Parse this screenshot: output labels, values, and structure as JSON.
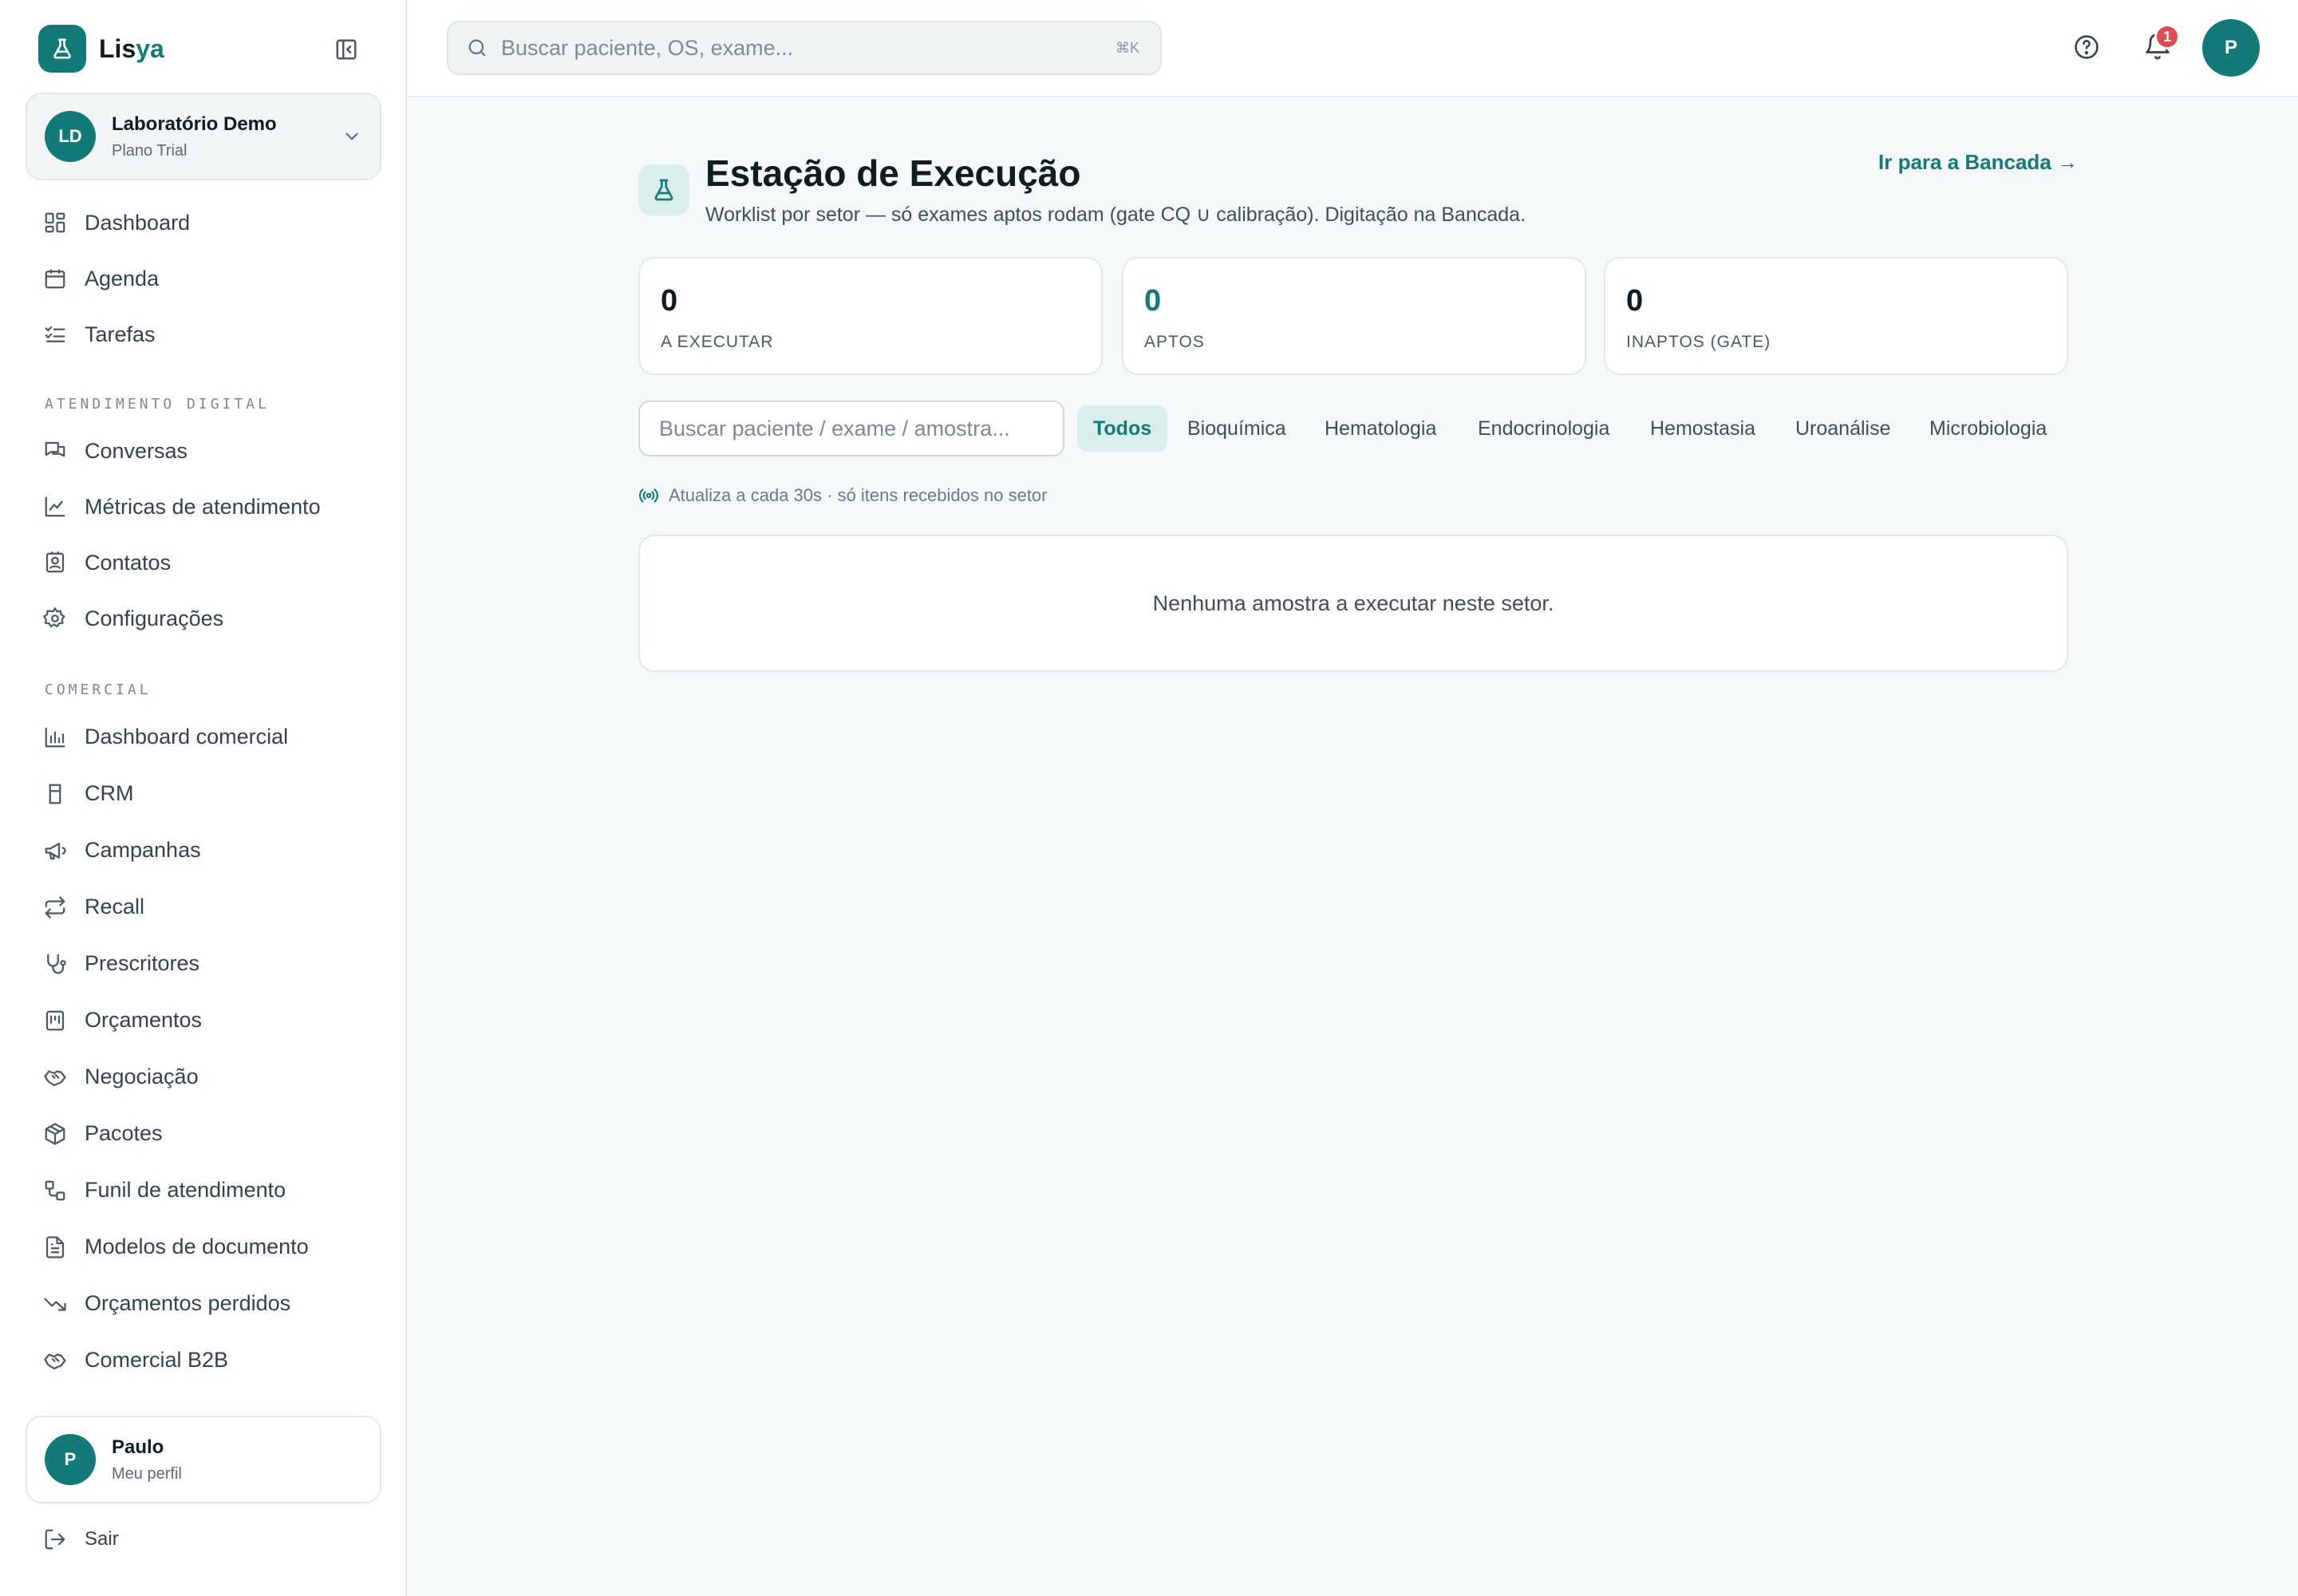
{
  "brand": {
    "name_part1": "Lis",
    "name_part2": "ya",
    "accent_color": "#137a78"
  },
  "org": {
    "initials": "LD",
    "name": "Laboratório Demo",
    "plan": "Plano Trial"
  },
  "sidebar": {
    "main_items": [
      {
        "label": "Dashboard",
        "icon": "layout-grid-icon"
      },
      {
        "label": "Agenda",
        "icon": "calendar-icon"
      },
      {
        "label": "Tarefas",
        "icon": "list-checks-icon"
      }
    ],
    "section_atendimento": "ATENDIMENTO DIGITAL",
    "atendimento_items": [
      {
        "label": "Conversas",
        "icon": "chat-bubbles-icon"
      },
      {
        "label": "Métricas de atendimento",
        "icon": "line-chart-icon"
      },
      {
        "label": "Contatos",
        "icon": "contact-card-icon"
      },
      {
        "label": "Configurações",
        "icon": "gear-icon"
      }
    ],
    "section_comercial": "COMERCIAL",
    "comercial_items": [
      {
        "label": "Dashboard comercial",
        "icon": "bar-chart-icon"
      },
      {
        "label": "CRM",
        "icon": "cylinder-icon"
      },
      {
        "label": "Campanhas",
        "icon": "megaphone-icon"
      },
      {
        "label": "Recall",
        "icon": "repeat-icon"
      },
      {
        "label": "Prescritores",
        "icon": "stethoscope-icon"
      },
      {
        "label": "Orçamentos",
        "icon": "receipt-icon"
      },
      {
        "label": "Negociação",
        "icon": "handshake-icon"
      },
      {
        "label": "Pacotes",
        "icon": "package-icon"
      },
      {
        "label": "Funil de atendimento",
        "icon": "workflow-icon"
      },
      {
        "label": "Modelos de documento",
        "icon": "file-text-icon"
      },
      {
        "label": "Orçamentos perdidos",
        "icon": "trending-down-icon"
      },
      {
        "label": "Comercial B2B",
        "icon": "handshake-icon"
      }
    ],
    "profile": {
      "initial": "P",
      "name": "Paulo",
      "sub": "Meu perfil"
    },
    "logout_label": "Sair"
  },
  "topbar": {
    "search_placeholder": "Buscar paciente, OS, exame...",
    "search_shortcut": "⌘K",
    "notifications_count": "1",
    "user_initial": "P"
  },
  "main": {
    "title": "Estação de Execução",
    "subtitle": "Worklist por setor — só exames aptos rodam (gate CQ ∪ calibração). Digitação na Bancada.",
    "bancada_link": "Ir para a Bancada →",
    "stats": [
      {
        "value": "0",
        "label": "A EXECUTAR"
      },
      {
        "value": "0",
        "label": "APTOS"
      },
      {
        "value": "0",
        "label": "INAPTOS (GATE)"
      }
    ],
    "filter_placeholder": "Buscar paciente / exame / amostra...",
    "sectors": [
      "Todos",
      "Bioquímica",
      "Hematologia",
      "Endocrinologia",
      "Hemostasia",
      "Uroanálise",
      "Microbiologia"
    ],
    "active_sector": "Todos",
    "refresh_note": "Atualiza a cada 30s · só itens recebidos no setor",
    "empty_message": "Nenhuma amostra a executar neste setor."
  }
}
